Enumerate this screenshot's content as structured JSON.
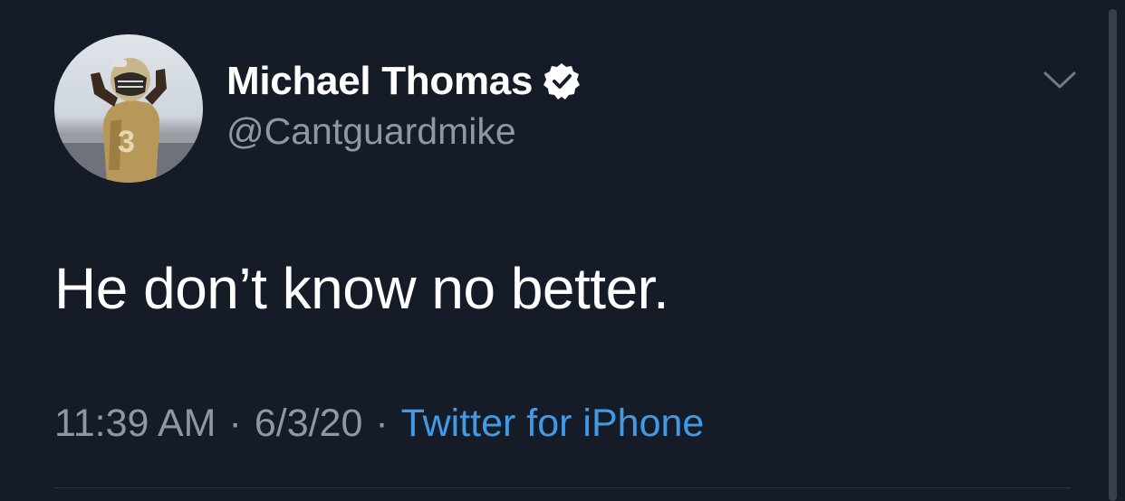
{
  "user": {
    "display_name": "Michael Thomas",
    "handle": "@Cantguardmike",
    "verified": true
  },
  "tweet": {
    "text": "He don’t know no better.",
    "time": "11:39 AM",
    "date": "6/3/20",
    "source": "Twitter for iPhone",
    "separator": "·"
  },
  "icons": {
    "verified": "verified-badge-icon",
    "more": "chevron-down-icon"
  },
  "colors": {
    "background": "#151c27",
    "primary_text": "#ffffff",
    "secondary_text": "#8b98a5",
    "link": "#3f9ae8"
  }
}
